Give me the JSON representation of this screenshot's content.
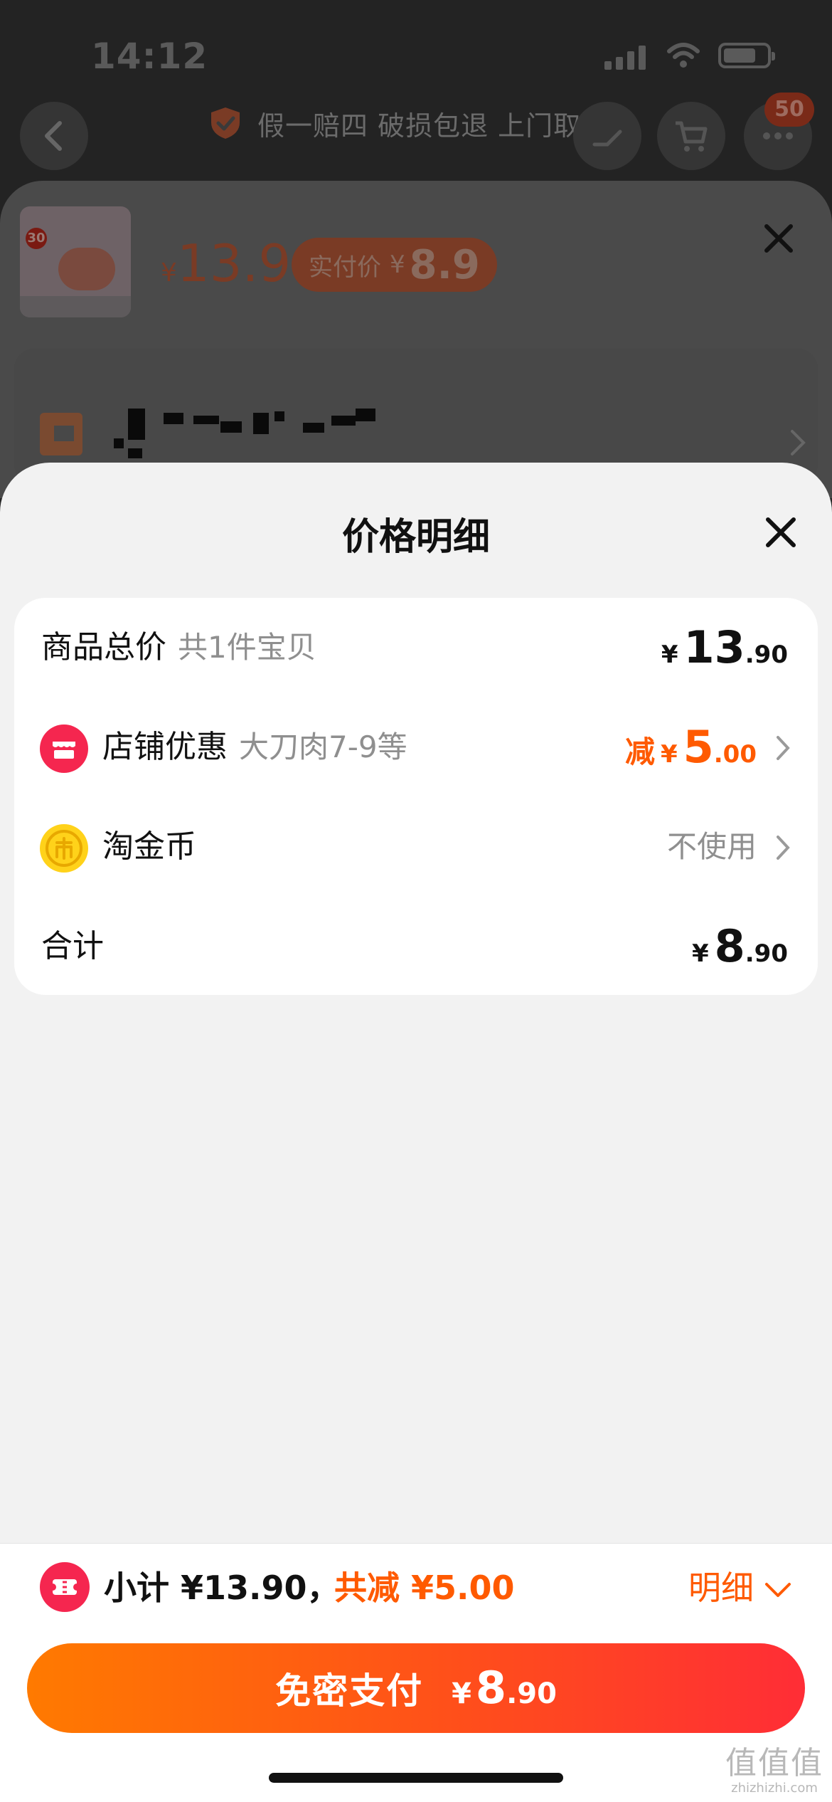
{
  "status_bar": {
    "time": "14:12"
  },
  "header": {
    "guarantee_text": "假一赔四 破损包退 上门取退",
    "cart_badge": "50"
  },
  "product": {
    "thumb_badge": "30",
    "currency": "¥",
    "price": "13.9",
    "paid_label": "实付价",
    "paid_currency": "¥",
    "paid_price": "8.9"
  },
  "modal": {
    "title": "价格明细",
    "rows": [
      {
        "label": "商品总价",
        "sub": "共1件宝贝",
        "currency": "¥",
        "int": "13",
        "dec": ".90"
      },
      {
        "label": "店铺优惠",
        "sub": "大刀肉7-9等",
        "prefix": "减",
        "currency": "¥",
        "int": "5",
        "dec": ".00",
        "icon": "store-icon",
        "color": "#ff5a00"
      },
      {
        "label": "淘金币",
        "value": "不使用",
        "icon": "gold-coin-icon"
      },
      {
        "label": "合计",
        "currency": "¥",
        "int": "8",
        "dec": ".90"
      }
    ]
  },
  "bottom": {
    "subtotal": "小计 ¥13.90，",
    "reduced": "共减 ¥5.00",
    "detail_label": "明细",
    "pay_label": "免密支付",
    "pay_currency": "¥",
    "pay_int": "8",
    "pay_dec": ".90"
  },
  "watermark": {
    "glyphs": "值值值",
    "domain": "zhizhizhi.com"
  },
  "colors": {
    "accent": "#ff5a00",
    "pay_gradient_start": "#ff7a00",
    "pay_gradient_end": "#ff2d36"
  }
}
